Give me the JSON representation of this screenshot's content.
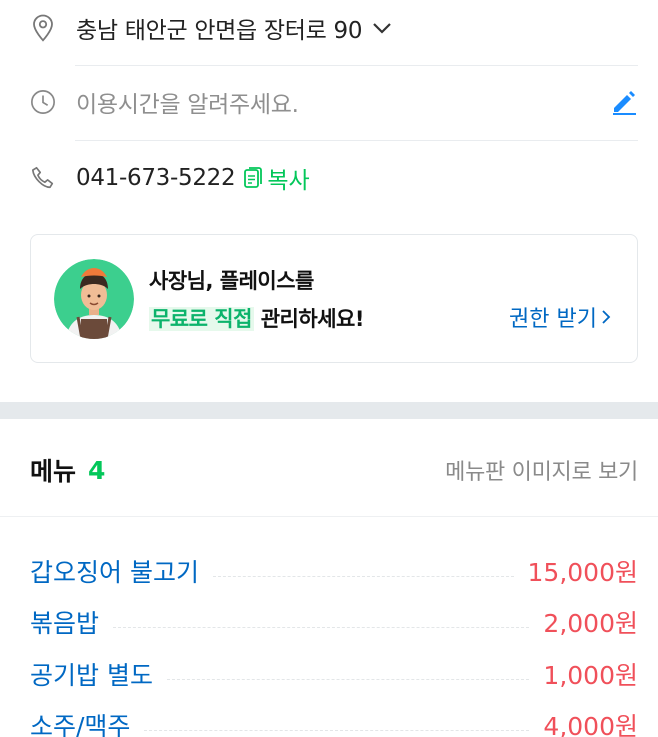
{
  "address": {
    "text": "충남 태안군 안면읍 장터로 90",
    "pin_icon": "map-pin-icon",
    "toggle_icon": "chevron-down-icon"
  },
  "hours": {
    "placeholder": "이용시간을 알려주세요.",
    "clock_icon": "clock-icon",
    "edit_icon": "pencil-icon"
  },
  "phone": {
    "number": "041-673-5222",
    "copy_label": "복사",
    "phone_icon": "phone-icon",
    "copy_icon": "copy-icon"
  },
  "owner_banner": {
    "line1": "사장님, 플레이스를",
    "highlight": "무료로 직접",
    "line2_rest": "관리하세요!",
    "permission_label": "권한 받기"
  },
  "menu": {
    "title": "메뉴",
    "count": "4",
    "view_board_label": "메뉴판 이미지로 보기",
    "items": [
      {
        "name": "갑오징어 불고기",
        "price": "15,000원"
      },
      {
        "name": "볶음밥",
        "price": "2,000원"
      },
      {
        "name": "공기밥 별도",
        "price": "1,000원"
      },
      {
        "name": "소주/맥주",
        "price": "4,000원"
      }
    ]
  },
  "colors": {
    "accent_green": "#03c75a",
    "link_blue": "#0068c3",
    "price_red": "#f0505a",
    "highlight_bg": "#e6f9ec"
  }
}
